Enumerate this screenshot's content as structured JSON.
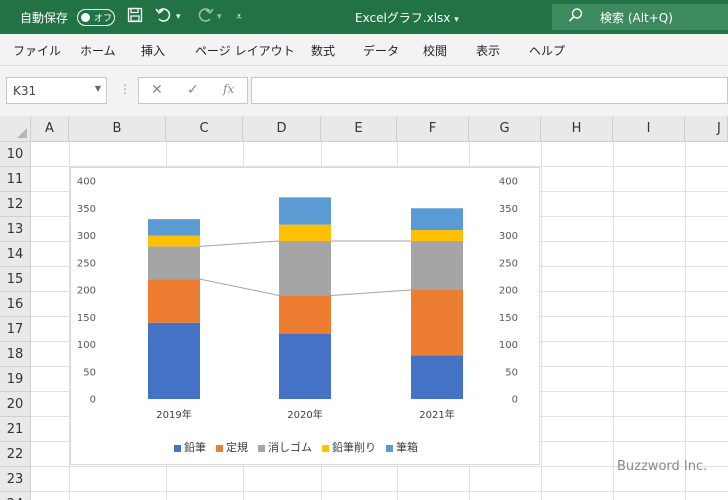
{
  "titlebar": {
    "autosave_label": "自動保存",
    "autosave_state": "オフ",
    "filename": "Excelグラフ.xlsx",
    "filename_caret": "▾",
    "search_placeholder": "検索 (Alt+Q)"
  },
  "menu": [
    "ファイル",
    "ホーム",
    "挿入",
    "ページ レイアウト",
    "数式",
    "データ",
    "校閲",
    "表示",
    "ヘルプ"
  ],
  "formula_bar": {
    "name_box": "K31",
    "cancel_glyph": "✕",
    "enter_glyph": "✓",
    "fx_glyph": "fx",
    "formula": ""
  },
  "columns": [
    "A",
    "B",
    "C",
    "D",
    "E",
    "F",
    "G",
    "H",
    "I",
    "J"
  ],
  "rows": [
    "10",
    "11",
    "12",
    "13",
    "14",
    "15",
    "16",
    "17",
    "18",
    "19",
    "20",
    "21",
    "22",
    "23",
    "24"
  ],
  "chart_data": {
    "type": "bar",
    "stacked": true,
    "categories": [
      "2019年",
      "2020年",
      "2021年"
    ],
    "y_ticks": [
      "400",
      "350",
      "300",
      "250",
      "200",
      "150",
      "100",
      "50",
      "0"
    ],
    "secondary_y_ticks": [
      "400",
      "350",
      "300",
      "250",
      "200",
      "150",
      "100",
      "50",
      "0"
    ],
    "ylim": [
      0,
      400
    ],
    "series": [
      {
        "name": "鉛筆",
        "color": "#4472c4",
        "values": [
          140,
          120,
          80
        ]
      },
      {
        "name": "定規",
        "color": "#ed7d31",
        "values": [
          80,
          70,
          120
        ]
      },
      {
        "name": "消しゴム",
        "color": "#a5a5a5",
        "values": [
          60,
          100,
          90
        ]
      },
      {
        "name": "鉛筆削り",
        "color": "#ffc000",
        "values": [
          20,
          30,
          20
        ]
      },
      {
        "name": "筆箱",
        "color": "#5b9bd5",
        "values": [
          30,
          50,
          40
        ]
      }
    ],
    "series_lines": true,
    "legend_position": "bottom",
    "grid": false
  },
  "watermark": "Buzzword Inc."
}
